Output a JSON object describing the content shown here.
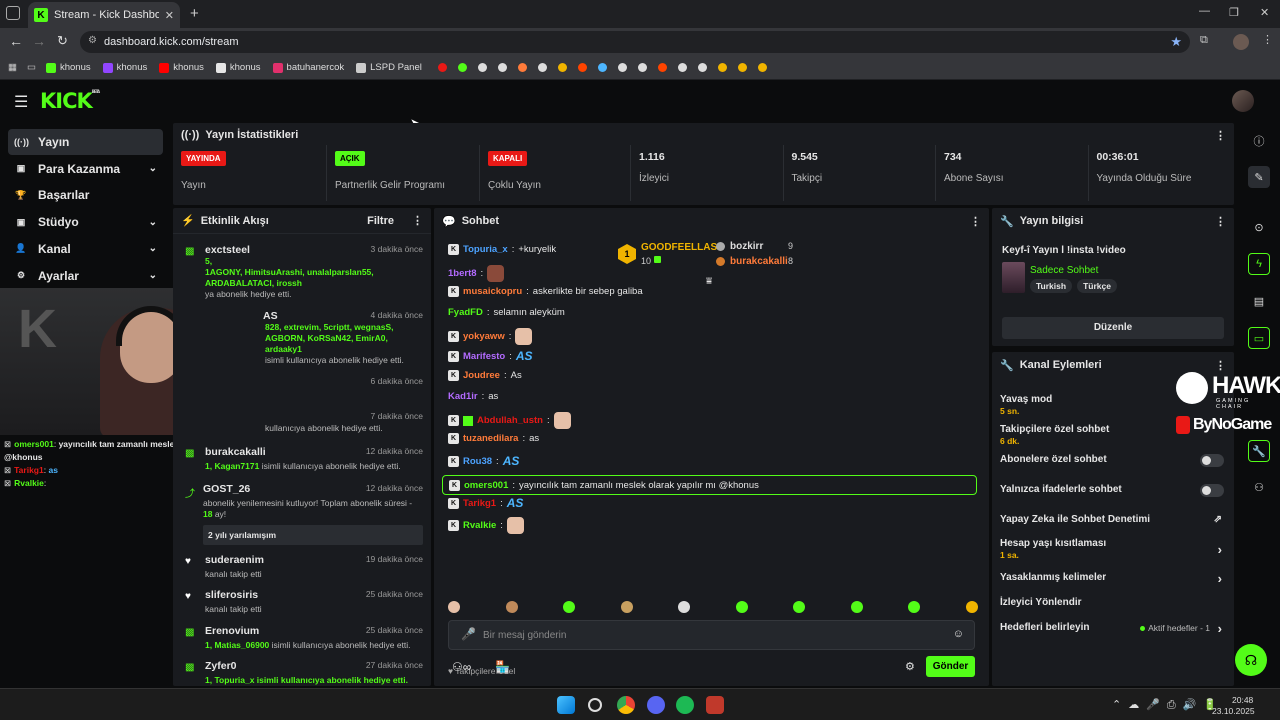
{
  "browser": {
    "tab_title": "Stream - Kick Dashboard",
    "new_tab": "+",
    "url": "dashboard.kick.com/stream",
    "bookmarks": [
      {
        "label": "khonus",
        "color": "#53fc18"
      },
      {
        "label": "khonus",
        "color": "#9146ff"
      },
      {
        "label": "khonus",
        "color": "#ff0000"
      },
      {
        "label": "khonus",
        "color": "#e6e6e6"
      },
      {
        "label": "batuhanercok",
        "color": "#e1306c"
      },
      {
        "label": "LSPD Panel",
        "color": "#cccccc"
      }
    ]
  },
  "app": {
    "logo": "KICK",
    "logo_sup": "BETA"
  },
  "sidebar": {
    "items": [
      {
        "label": "Yayın",
        "icon": "broadcast-icon",
        "active": true,
        "chevron": false
      },
      {
        "label": "Para Kazanma",
        "icon": "money-icon",
        "chevron": true
      },
      {
        "label": "Başarılar",
        "icon": "trophy-icon",
        "chevron": false
      },
      {
        "label": "Stüdyo",
        "icon": "studio-icon",
        "chevron": true
      },
      {
        "label": "Kanal",
        "icon": "channel-icon",
        "chevron": true
      },
      {
        "label": "Ayarlar",
        "icon": "gear-icon",
        "chevron": true
      }
    ]
  },
  "stats": {
    "title": "Yayın İstatistikleri",
    "badges": [
      {
        "badge": "YAYINDA",
        "label": "Yayın",
        "color": "#e91916"
      },
      {
        "badge": "AÇIK",
        "label": "Partnerlik Gelir Programı",
        "color": "#53fc18"
      },
      {
        "badge": "KAPALI",
        "label": "Çoklu Yayın",
        "color": "#e91916"
      }
    ],
    "numbers": [
      {
        "value": "1.116",
        "label": "İzleyici"
      },
      {
        "value": "9.545",
        "label": "Takipçi"
      },
      {
        "value": "734",
        "label": "Abone Sayısı"
      },
      {
        "value": "00:36:01",
        "label": "Yayında Olduğu Süre"
      }
    ]
  },
  "activity": {
    "title": "Etkinlik Akışı",
    "filter": "Filtre",
    "items": [
      {
        "name": "exctsteel",
        "time": "3 dakika önce",
        "line1": "5,",
        "line2": "1AGONY, HimitsuArashi, unalalparslan55,",
        "line3": "ARDABALATACI, irossh",
        "line4": "ya abonelik hediye etti."
      },
      {
        "name": "AS",
        "time": "4 dakika önce",
        "line1": "828, extrevim, 5criptt, wegnasS,",
        "line2": "AGBORN, KoRSaN42, EmirA0, ardaaky1",
        "line3": "isimli kullanıcıya abonelik hediye etti."
      },
      {
        "time6": "6 dakika önce"
      },
      {
        "time7": "7 dakika önce",
        "line": "kullanıcıya abonelik hediye etti."
      },
      {
        "name": "burakcakalli",
        "time": "12 dakika önce",
        "highlight": "1, Kagan7171",
        "rest": " isimli kullanıcıya abonelik hediye etti."
      },
      {
        "name": "GOST_26",
        "time": "12 dakika önce",
        "sub": "abonelik yenilemesini kutluyor! Toplam abonelik süresi -",
        "months": "18",
        "months_suffix": " ay!",
        "msg": "2 yılı yarılamışım"
      },
      {
        "name": "suderaenim",
        "time": "19 dakika önce",
        "sub": "kanalı takip etti"
      },
      {
        "name": "sliferosiris",
        "time": "25 dakika önce",
        "sub": "kanalı takip etti"
      },
      {
        "name": "Erenovium",
        "time": "25 dakika önce",
        "highlight": "1, Matias_06900",
        "rest": " isimli kullanıcıya abonelik hediye etti."
      },
      {
        "name": "Zyfer0",
        "time": "27 dakika önce",
        "sub": "1, Topuria_x isimli kullanıcıya abonelik hediye etti."
      }
    ]
  },
  "chat": {
    "title": "Sohbet",
    "leaders": {
      "first": {
        "name": "GOODFEELLAS",
        "count": "10"
      },
      "second": {
        "name": "bozkirr",
        "count": "9"
      },
      "third": {
        "name": "burakcakalli",
        "count": "8"
      }
    },
    "messages": [
      {
        "user": "Topuria_x",
        "color": "#4da3ff",
        "text": " +kuryelik"
      },
      {
        "user": "1bert8",
        "color": "#b36bff",
        "text": ""
      },
      {
        "user": "musaickopru",
        "color": "#ff7b3a",
        "text": " askerlikte bir sebep galiba"
      },
      {
        "user": "FyadFD",
        "color": "#53fc18",
        "text": " selamın aleyküm"
      },
      {
        "user": "yokyaww",
        "color": "#ff7b3a",
        "text": ""
      },
      {
        "user": "Marifesto",
        "color": "#b36bff",
        "text": "",
        "emote": "AS"
      },
      {
        "user": "Joudree",
        "color": "#ff7b3a",
        "text": " As"
      },
      {
        "user": "Kad1ir",
        "color": "#b36bff",
        "text": " as"
      },
      {
        "user": "Abdullah_ustn",
        "color": "#e91916",
        "text": ""
      },
      {
        "user": "tuzanedilara",
        "color": "#ff7b3a",
        "text": " as"
      },
      {
        "user": "Rou38",
        "color": "#4da3ff",
        "text": "",
        "emote": "AS"
      },
      {
        "user": "omers001",
        "color": "#53fc18",
        "text": " yayıncılık tam zamanlı meslek olarak yapılır mı @khonus"
      },
      {
        "user": "Tarikg1",
        "color": "#e91916",
        "text": "",
        "emote": "AS"
      },
      {
        "user": "Rvalkie",
        "color": "#53fc18",
        "text": ""
      }
    ],
    "followers_only": "Takipçilere Özel",
    "input_placeholder": "Bir mesaj gönderin",
    "send": "Gönder"
  },
  "overlay": {
    "chat": [
      {
        "user": "omers001",
        "color": "#53fc18",
        "text": " yayıncılık tam zamanlı meslek olarak yapılır mı"
      },
      {
        "user": "",
        "text": "@khonus"
      },
      {
        "user": "Tarikg1",
        "color": "#e91916",
        "text": " as"
      },
      {
        "user": "Rvalkie",
        "color": "#53fc18",
        "text": ""
      }
    ],
    "sponsor1": "HAWK",
    "sponsor1_sub": "GAMING CHAIR",
    "sponsor2": "ByNoGame"
  },
  "stream_info": {
    "title": "Yayın bilgisi",
    "stream_title": "Keyf-î Yayın l !insta !video",
    "category": "Sadece Sohbet",
    "tags": [
      "Turkish",
      "Türkçe"
    ],
    "edit": "Düzenle"
  },
  "channel_actions": {
    "title": "Kanal Eylemleri",
    "rows": [
      {
        "label": "Yavaş mod",
        "value": "5 sn."
      },
      {
        "label": "Takipçilere özel sohbet",
        "value": "6 dk."
      },
      {
        "label": "Abonelere özel sohbet",
        "toggle": true
      },
      {
        "label": "Yalnızca ifadelerle sohbet",
        "toggle": true
      },
      {
        "label": "Yapay Zeka ile Sohbet Denetimi"
      },
      {
        "label": "Hesap yaşı kısıtlaması",
        "value": "1 sa."
      },
      {
        "label": "Yasaklanmış kelimeler"
      },
      {
        "label": "İzleyici Yönlendir"
      },
      {
        "label": "Hedefleri belirleyin",
        "status": "Aktif hedefler - 1"
      }
    ]
  },
  "taskbar": {
    "time": "20:48",
    "date": "23.10.2025"
  },
  "colors": {
    "accent": "#53fc18",
    "live": "#e91916",
    "panel": "#191b1f",
    "bg": "#0b0c0d"
  }
}
